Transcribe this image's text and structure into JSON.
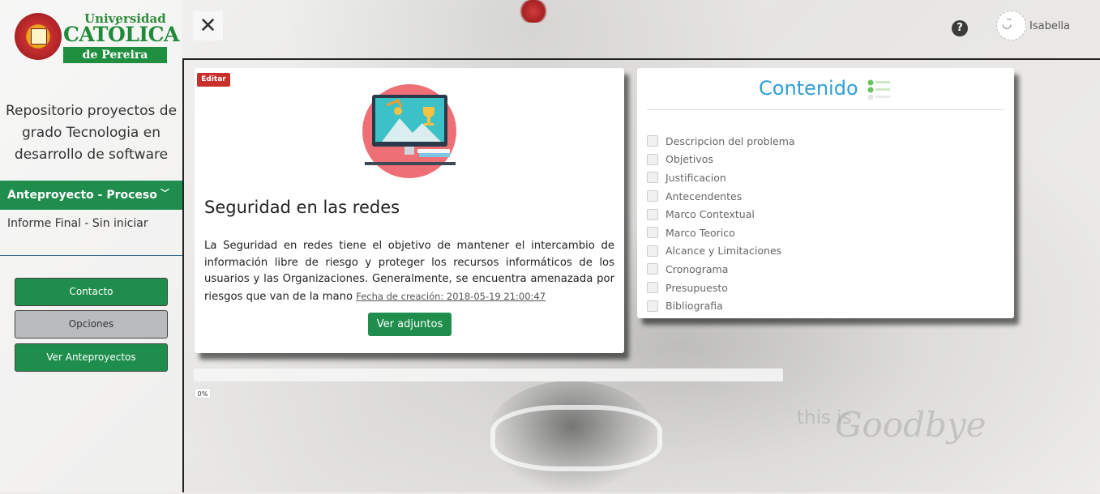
{
  "logo": {
    "line1": "Universidad",
    "line2": "CATÓLICA",
    "line3": "de Pereira"
  },
  "sidebar": {
    "repo_title": "Repositorio proyectos de grado Tecnologia en desarrollo de software",
    "active_item": "Anteproyecto - Proceso",
    "item": "Informe Final - Sin iniciar",
    "buttons": {
      "contacto": "Contacto",
      "opciones": "Opciones",
      "ver_anteproyectos": "Ver Anteproyectos"
    }
  },
  "topbar": {
    "close_symbol": "✕",
    "help_symbol": "?",
    "user_name": "Isabella"
  },
  "project": {
    "edit_label": "Editar",
    "title": "Seguridad en las redes",
    "description": "La Seguridad en redes tiene el objetivo de mantener el intercambio de información libre de riesgo y proteger los recursos informáticos de los usuarios y las Organizaciones. Generalmente, se encuentra amenazada por riesgos que van de la mano",
    "date": "Fecha de creación: 2018-05-19 21:00:47",
    "attachments_button": "Ver adjuntos"
  },
  "progress": {
    "value": 0,
    "label": "0%"
  },
  "contents": {
    "title": "Contenido",
    "items": [
      "Descripcion del problema",
      "Objetivos",
      "Justificacion",
      "Antecendentes",
      "Marco Contextual",
      "Marco Teorico",
      "Alcance y Limitaciones",
      "Cronograma",
      "Presupuesto",
      "Bibliografia"
    ]
  },
  "colors": {
    "brand_green": "#1f8e4c",
    "accent_blue": "#2f9fd8",
    "badge_red": "#c9302c"
  },
  "icons": [
    "close-icon",
    "help-icon",
    "avatar-icon",
    "checklist-icon",
    "chevron-down-icon"
  ]
}
